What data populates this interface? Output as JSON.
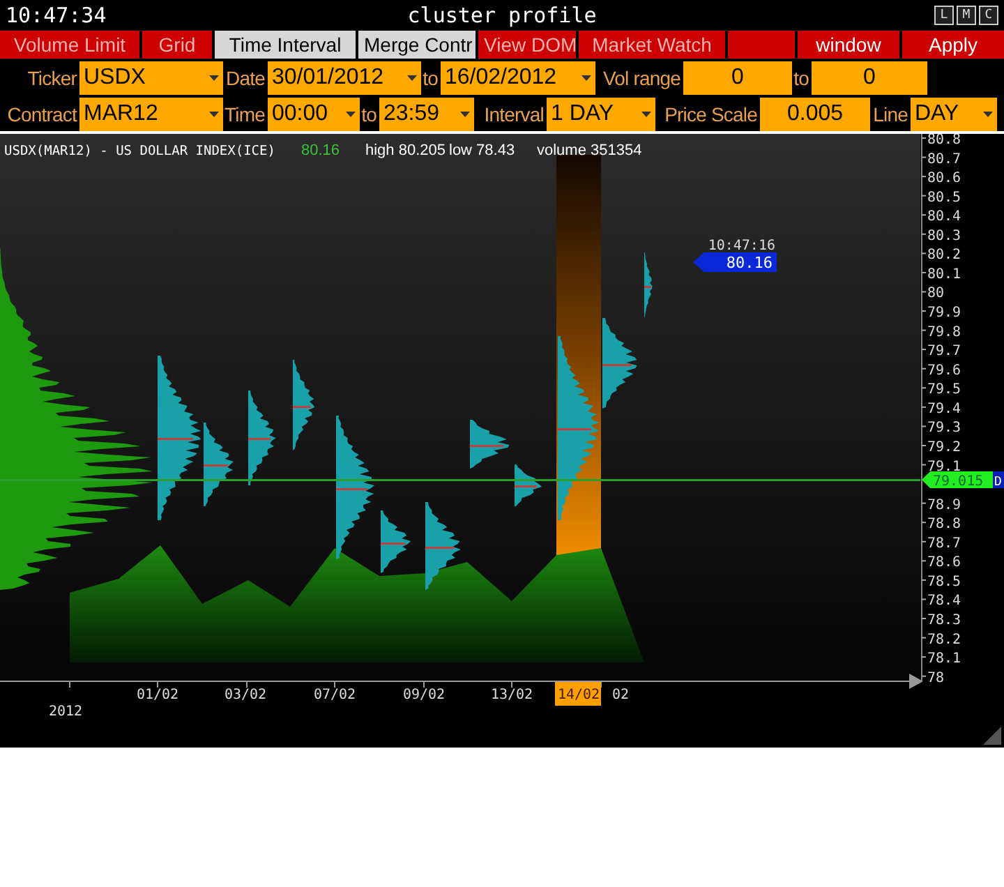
{
  "title_bar": {
    "time": "10:47:34",
    "title": "cluster profile",
    "buttons": [
      "L",
      "M",
      "C"
    ]
  },
  "menu": [
    {
      "kind": "tab",
      "label": "Volume Limit",
      "selected": false
    },
    {
      "kind": "tab",
      "label": "Grid",
      "selected": false
    },
    {
      "kind": "tab",
      "label": "Time Interval",
      "selected": true
    },
    {
      "kind": "tab",
      "label": "Merge Contr",
      "selected": true
    },
    {
      "kind": "tab",
      "label": "View DOM",
      "selected": false
    },
    {
      "kind": "tab",
      "label": "Market Watch",
      "selected": false
    },
    {
      "kind": "action",
      "label": "window",
      "selected": false
    },
    {
      "kind": "action",
      "label": "Apply",
      "selected": false
    }
  ],
  "filters": [
    [
      {
        "kind": "label",
        "text": "Ticker"
      },
      {
        "kind": "dropdown",
        "value": "USDX"
      },
      {
        "kind": "label",
        "text": "Date"
      },
      {
        "kind": "dropdown",
        "value": "30/01/2012"
      },
      {
        "kind": "label",
        "text": "to"
      },
      {
        "kind": "dropdown",
        "value": "16/02/2012"
      },
      {
        "kind": "label",
        "text": "Vol range"
      },
      {
        "kind": "field",
        "value": "0"
      },
      {
        "kind": "label",
        "text": "to"
      },
      {
        "kind": "field",
        "value": "0"
      }
    ],
    [
      {
        "kind": "label",
        "text": "Contract"
      },
      {
        "kind": "dropdown",
        "value": "MAR12"
      },
      {
        "kind": "label",
        "text": "Time"
      },
      {
        "kind": "dropdown",
        "value": "00:00"
      },
      {
        "kind": "label",
        "text": "to"
      },
      {
        "kind": "dropdown",
        "value": "23:59"
      },
      {
        "kind": "label",
        "text": "Interval"
      },
      {
        "kind": "dropdown",
        "value": "1 DAY"
      },
      {
        "kind": "label",
        "text": "Price Scale"
      },
      {
        "kind": "field",
        "value": "0.005"
      },
      {
        "kind": "label",
        "text": "Line"
      },
      {
        "kind": "dropdown",
        "value": "DAY"
      }
    ]
  ],
  "chart": {
    "header": {
      "symbol": "USDX(MAR12) - US DOLLAR INDEX(ICE)",
      "last": "80.16",
      "high": "high 80.205",
      "low": "low 78.43",
      "volume": "volume 351354"
    },
    "price_tag": {
      "time": "10:47:16",
      "price": "80.16"
    },
    "line_marker": {
      "price": "79.015",
      "flag": "D"
    },
    "y_labels": [
      "80.8",
      "80.7",
      "80.6",
      "80.5",
      "80.4",
      "80.3",
      "80.2",
      "80.1",
      "80",
      "79.9",
      "79.8",
      "79.7",
      "79.6",
      "79.5",
      "79.4",
      "79.3",
      "79.2",
      "79.1",
      "78.9",
      "78.8",
      "78.7",
      "78.6",
      "78.5",
      "78.4",
      "78.3",
      "78.2",
      "78.1",
      "78"
    ],
    "x_labels": [
      {
        "text": "01/02",
        "selected": false
      },
      {
        "text": "03/02",
        "selected": false
      },
      {
        "text": "07/02",
        "selected": false
      },
      {
        "text": "09/02",
        "selected": false
      },
      {
        "text": "13/02",
        "selected": false
      },
      {
        "text": "14/02",
        "selected": true
      },
      {
        "text": "02",
        "selected": false
      }
    ],
    "year": "2012"
  }
}
